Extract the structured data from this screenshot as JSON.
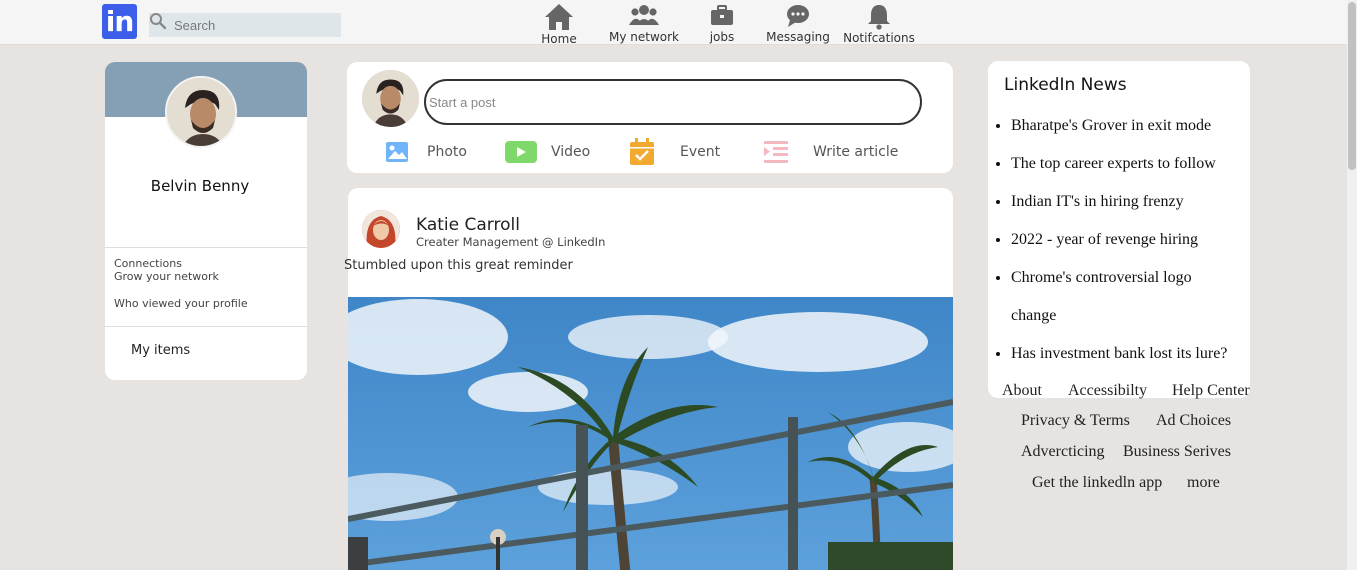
{
  "nav": {
    "search_placeholder": "Search",
    "items": [
      {
        "label": "Home",
        "icon": "home-icon"
      },
      {
        "label": "My network",
        "icon": "network-icon"
      },
      {
        "label": "jobs",
        "icon": "briefcase-icon"
      },
      {
        "label": "Messaging",
        "icon": "message-icon"
      },
      {
        "label": "Notifcations",
        "icon": "bell-icon"
      }
    ]
  },
  "logo": "in",
  "profile": {
    "name": "Belvin Benny",
    "connections": "Connections",
    "grow": "Grow your network",
    "viewed": "Who viewed your profile",
    "items": "My items"
  },
  "composer": {
    "placeholder": "Start a post",
    "actions": [
      {
        "label": "Photo",
        "icon": "photo-icon",
        "color": "#70b5f9"
      },
      {
        "label": "Video",
        "icon": "video-icon",
        "color": "#7fc15e"
      },
      {
        "label": "Event",
        "icon": "calendar-icon",
        "color": "#e7a33e"
      },
      {
        "label": "Write article",
        "icon": "article-icon",
        "color": "#f5b7c0"
      }
    ]
  },
  "post": {
    "author": "Katie Carroll",
    "role": "Creater Management @ LinkedIn",
    "text": "Stumbled upon this great reminder"
  },
  "news": {
    "title": "LinkedIn News",
    "items": [
      "Bharatpe's Grover in exit mode",
      "The top career experts to follow",
      "Indian IT's in hiring frenzy",
      "2022 - year of revenge hiring",
      "Chrome's controversial logo change",
      "Has investment bank lost its lure?"
    ]
  },
  "footer": {
    "links": [
      "About",
      "Accessibilty",
      "Help Center",
      "Privacy & Terms",
      "Ad Choices",
      "Advercticing",
      "Business Serives",
      "Get the linkedln app",
      "more"
    ]
  },
  "colors": {
    "brand": "#3c5ee8",
    "banner": "#85a0b5",
    "background": "#e6e3e0"
  }
}
